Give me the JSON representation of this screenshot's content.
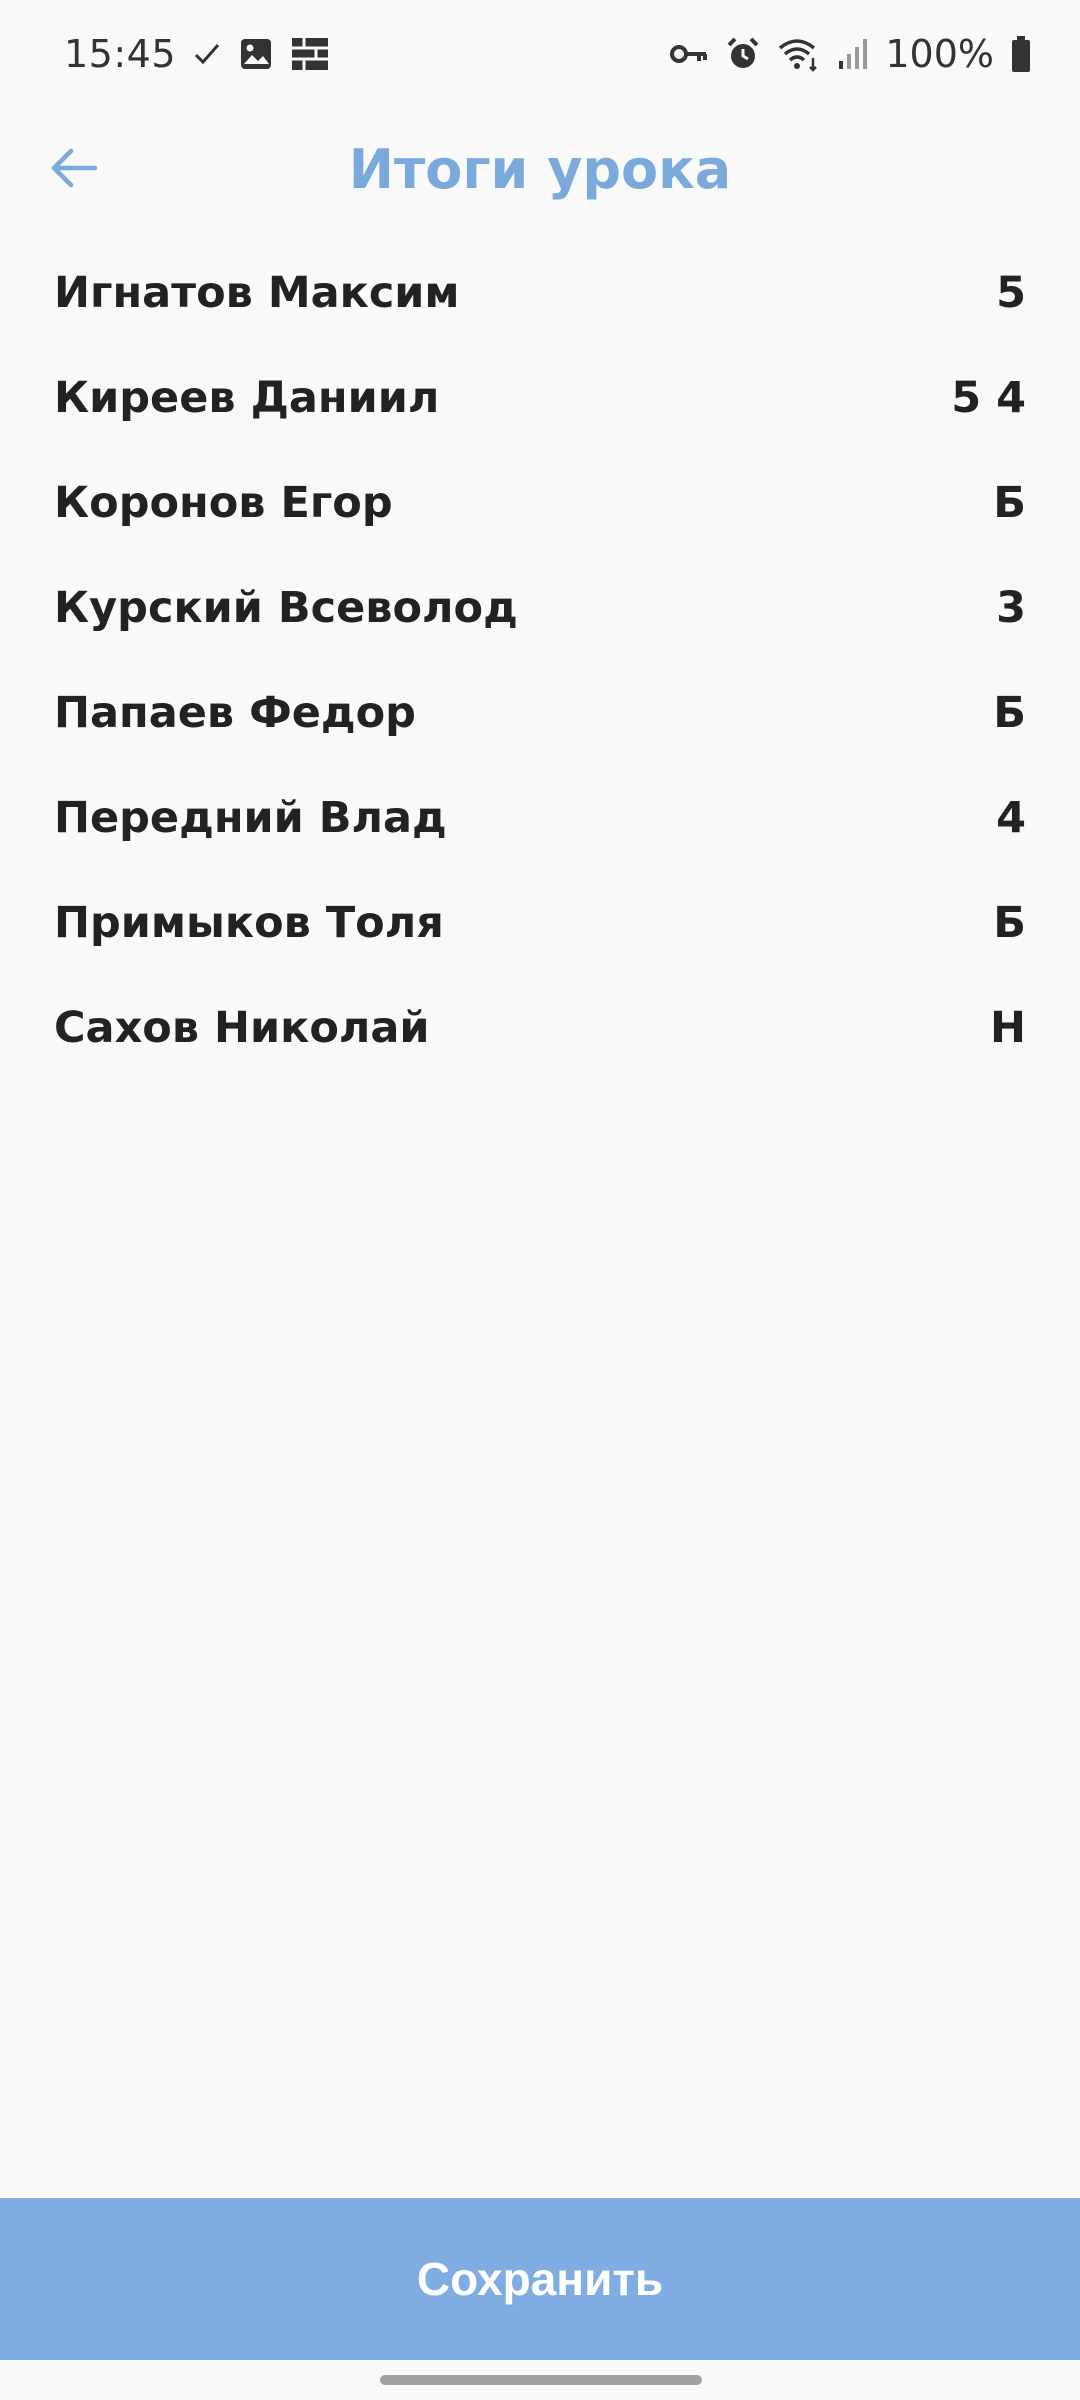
{
  "status_bar": {
    "time": "15:45",
    "battery_percent": "100%",
    "left_icons": [
      "check-icon",
      "image-icon",
      "grid-icon"
    ],
    "right_icons": [
      "vpn-key-icon",
      "alarm-icon",
      "wifi-icon",
      "signal-icon",
      "battery-icon"
    ]
  },
  "header": {
    "title": "Итоги урока",
    "back_icon": "arrow-left-icon"
  },
  "results": [
    {
      "name": "Игнатов Максим",
      "grade": "5"
    },
    {
      "name": "Киреев Даниил",
      "grade": "5 4"
    },
    {
      "name": "Коронов Егор",
      "grade": "Б"
    },
    {
      "name": "Курский Всеволод",
      "grade": "3"
    },
    {
      "name": "Папаев Федор",
      "grade": "Б"
    },
    {
      "name": "Передний Влад",
      "grade": "4"
    },
    {
      "name": "Примыков Толя",
      "grade": "Б"
    },
    {
      "name": "Сахов Николай",
      "grade": "Н"
    }
  ],
  "footer": {
    "save_label": "Сохранить"
  },
  "colors": {
    "accent": "#7aa9dc",
    "button": "#7fade1",
    "text": "#222222",
    "background": "#f9f9f9"
  }
}
